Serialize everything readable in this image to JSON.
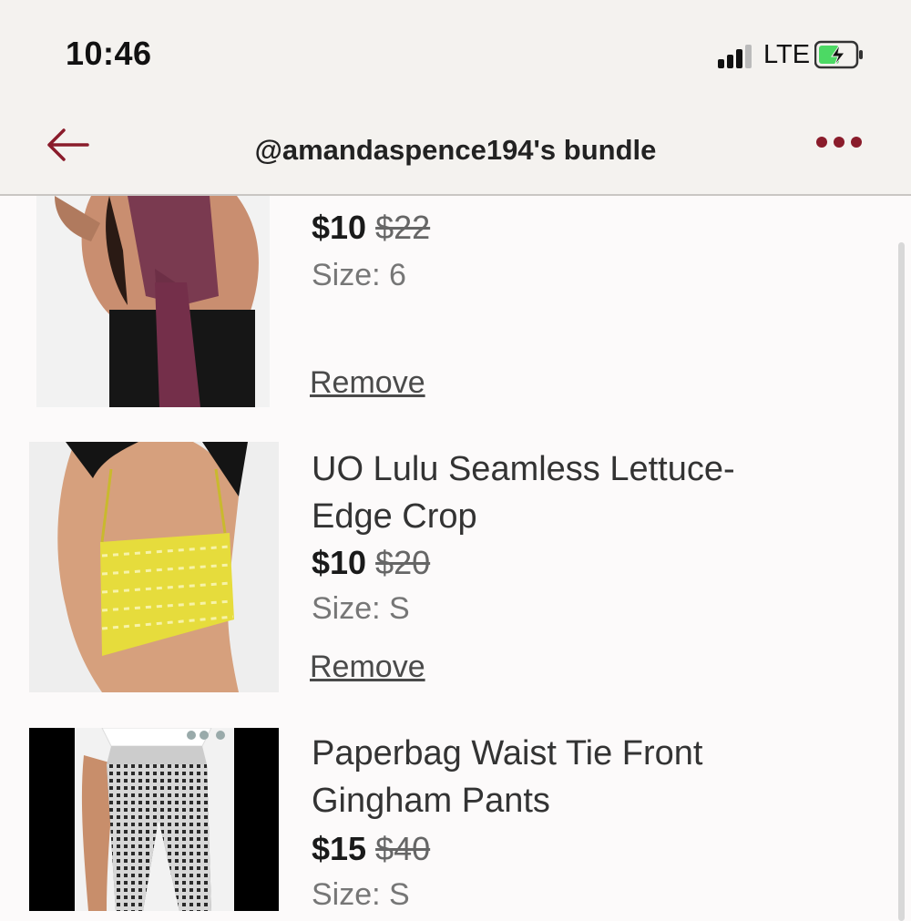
{
  "status_bar": {
    "time": "10:46",
    "network": "LTE",
    "signal_icon": "signal-bars-icon",
    "battery_icon": "battery-charging-icon"
  },
  "header": {
    "title": "@amandaspence194's bundle",
    "back_icon": "back-arrow-icon",
    "more_icon": "more-dots-icon",
    "accent": "#8a1c2b"
  },
  "items": [
    {
      "title": "",
      "price": "$10",
      "original_price": "$22",
      "size": "Size: 6",
      "remove": "Remove"
    },
    {
      "title_line1": "UO Lulu Seamless Lettuce-",
      "title_line2": "Edge Crop",
      "price": "$10",
      "original_price": "$20",
      "size": "Size: S",
      "remove": "Remove"
    },
    {
      "title_line1": "Paperbag Waist Tie Front",
      "title_line2": "Gingham Pants",
      "price": "$15",
      "original_price": "$40",
      "size": "Size: S"
    }
  ]
}
